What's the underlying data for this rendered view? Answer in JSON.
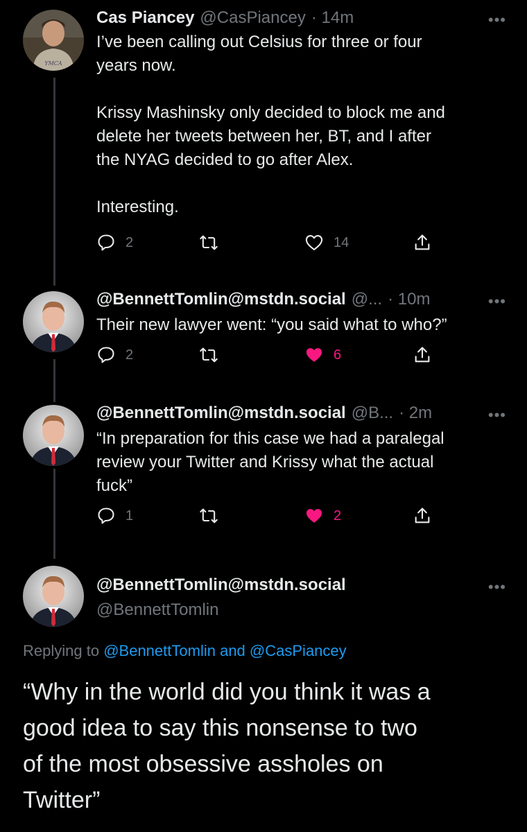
{
  "tweets": [
    {
      "name": "Cas Piancey",
      "handle": "@CasPiancey",
      "time": "· 14m",
      "text": "I’ve been calling out Celsius for three or four\nyears now.\n\nKrissy Mashinsky only decided to block me and\ndelete her tweets between her, BT, and I after\nthe NYAG decided to go after Alex.\n\nInteresting.",
      "replies": "2",
      "likes": "14",
      "liked": false,
      "avatar_shirt_text": "YMCA"
    },
    {
      "name": "@BennettTomlin@mstdn.social",
      "handle": "@...",
      "time": "· 10m",
      "text": "Their new lawyer went: “you said what to who?”",
      "replies": "2",
      "likes": "6",
      "liked": true
    },
    {
      "name": "@BennettTomlin@mstdn.social",
      "handle": "@B...",
      "time": "· 2m",
      "text": "“In preparation for this case we had a paralegal\nreview your Twitter and Krissy what the actual\nfuck”",
      "replies": "1",
      "likes": "2",
      "liked": true
    }
  ],
  "main_tweet": {
    "name": "@BennettTomlin@mstdn.social",
    "handle": "@BennettTomlin",
    "replying_prefix": "Replying to",
    "replying_user1": "@BennettTomlin",
    "replying_and": "and",
    "replying_user2": "@CasPiancey",
    "text": "“Why in the world did you think it was a\ngood idea to say this nonsense to two\nof the most obsessive assholes on\nTwitter”"
  },
  "more_label": "•••",
  "colors": {
    "background": "#000000",
    "text": "#e7e9ea",
    "muted": "#71767b",
    "like": "#f91880",
    "link": "#1d9bf0"
  }
}
